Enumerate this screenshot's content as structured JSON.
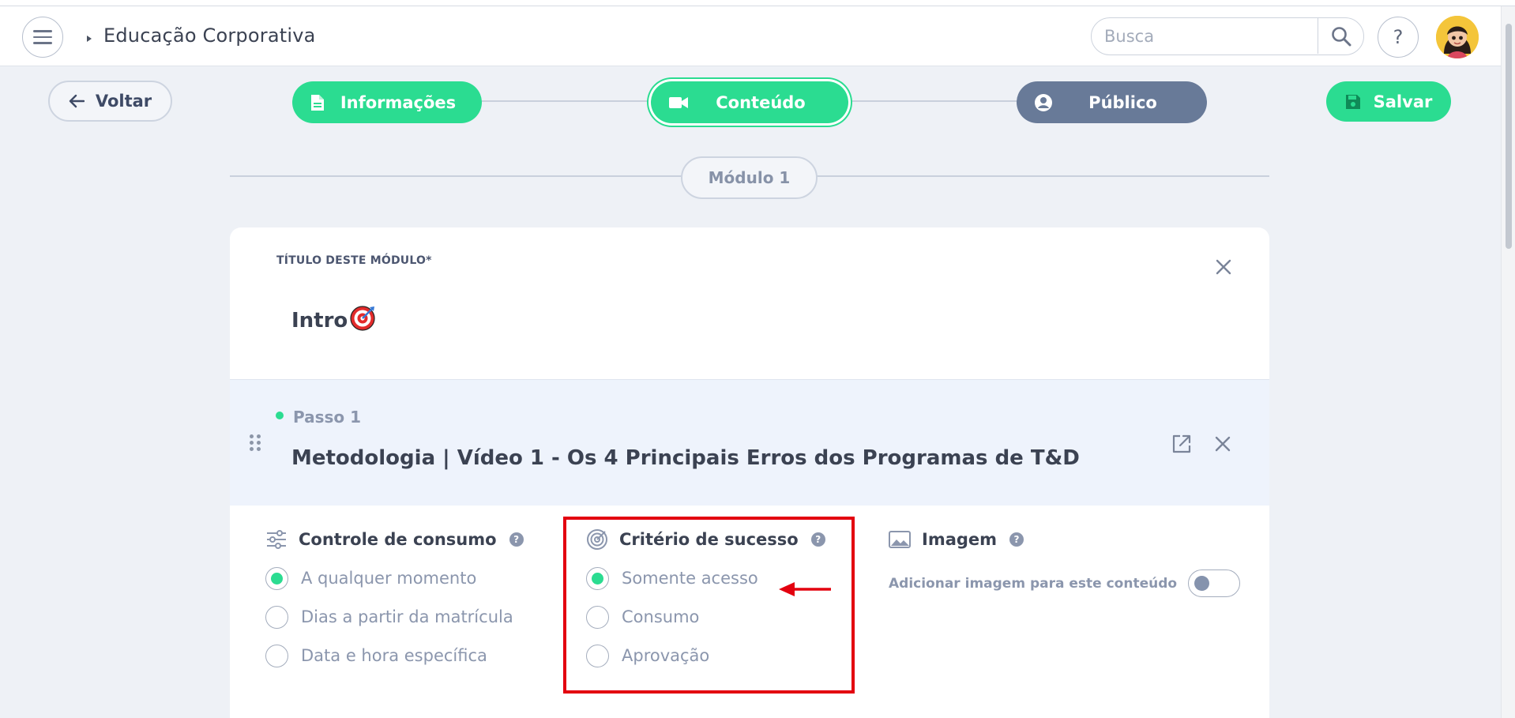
{
  "header": {
    "breadcrumb_title": "Educação Corporativa",
    "search_placeholder": "Busca",
    "help_label": "?"
  },
  "steps_nav": {
    "back_label": "Voltar",
    "steps": [
      {
        "label": "Informações",
        "state": "completed",
        "color": "#2bdc91"
      },
      {
        "label": "Conteúdo",
        "state": "active",
        "color": "#2bdc91"
      },
      {
        "label": "Público",
        "state": "pending",
        "color": "#687a98"
      }
    ],
    "save_label": "Salvar"
  },
  "module": {
    "pill_label": "Módulo 1",
    "field_label": "TÍTULO DESTE MÓDULO*",
    "title_value": "Intro",
    "title_emoji": "target-emoji"
  },
  "step_item": {
    "step_label": "Passo 1",
    "title": "Metodologia | Vídeo 1 - Os 4 Principais Erros dos Programas de T&D"
  },
  "consumo": {
    "title": "Controle de consumo",
    "options": [
      {
        "label": "A qualquer momento",
        "checked": true
      },
      {
        "label": "Dias a partir da matrícula",
        "checked": false
      },
      {
        "label": "Data e hora específica",
        "checked": false
      }
    ]
  },
  "criterio": {
    "title": "Critério de sucesso",
    "options": [
      {
        "label": "Somente acesso",
        "checked": true
      },
      {
        "label": "Consumo",
        "checked": false
      },
      {
        "label": "Aprovação",
        "checked": false
      }
    ]
  },
  "imagem": {
    "title": "Imagem",
    "toggle_label": "Adicionar imagem para este conteúdo",
    "toggle_on": false
  },
  "annotation": {
    "highlight_color": "#e3000f"
  },
  "colors": {
    "accent": "#2bdc91",
    "muted": "#687a98"
  }
}
